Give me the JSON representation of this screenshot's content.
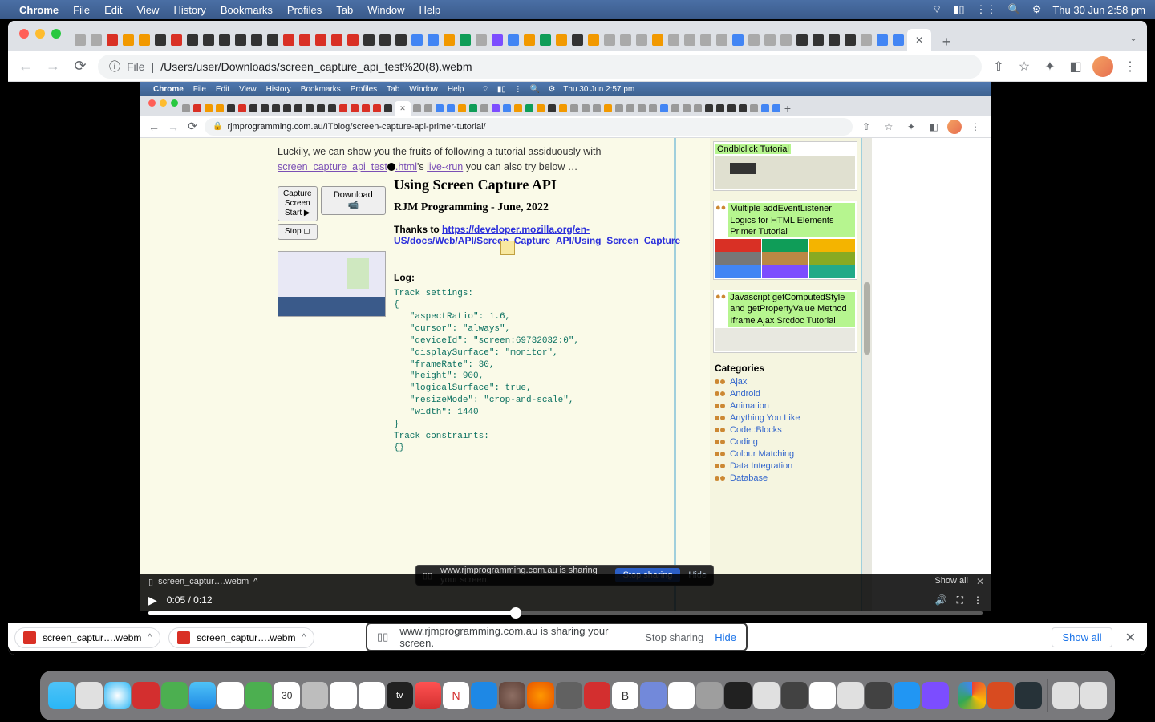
{
  "mac_menubar": {
    "app": "Chrome",
    "items": [
      "File",
      "Edit",
      "View",
      "History",
      "Bookmarks",
      "Profiles",
      "Tab",
      "Window",
      "Help"
    ],
    "clock": "Thu 30 Jun  2:58 pm"
  },
  "chrome": {
    "url_proto": "File",
    "url_path": "/Users/user/Downloads/screen_capture_api_test%20(8).webm",
    "info_icon": "ⓘ"
  },
  "inner_menubar": {
    "app": "Chrome",
    "items": [
      "File",
      "Edit",
      "View",
      "History",
      "Bookmarks",
      "Profiles",
      "Tab",
      "Window",
      "Help"
    ],
    "clock": "Thu 30 Jun  2:57 pm"
  },
  "inner_chrome": {
    "url": "rjmprogramming.com.au/ITblog/screen-capture-api-primer-tutorial/"
  },
  "blog": {
    "intro_a": "Luckily, we can show you the fruits of following a tutorial assiduously with ",
    "link1": "screen_capture_api_test",
    "link1_ext": ".html",
    "intro_b": "'s ",
    "link2": "live‑‹run",
    "intro_c": " you can also try below …",
    "btn_capture": "Capture\nScreen\nStart ▶",
    "btn_stop": "Stop ◻",
    "btn_download": "Download 📹",
    "title": "Using Screen Capture API",
    "subtitle": "RJM Programming - June, 2022",
    "thanks_pre": "Thanks to ",
    "thanks_link": "https://developer.mozilla.org/en-US/docs/Web/API/Screen_Capture_API/Using_Screen_Capture_",
    "log_label": "Log:",
    "log_pre": "Track settings:\n{\n   \"aspectRatio\": 1.6,\n   \"cursor\": \"always\",\n   \"deviceId\": \"screen:69732032:0\",\n   \"displaySurface\": \"monitor\",\n   \"frameRate\": 30,\n   \"height\": 900,\n   \"logicalSurface\": true,\n   \"resizeMode\": \"crop-and-scale\",\n   \"width\": 1440\n}\nTrack constraints:\n{}"
  },
  "sidebar": {
    "card1": "Ondblclick Tutorial",
    "card2": "Multiple addEventListener Logics for HTML Elements Primer Tutorial",
    "card3": "Javascript getComputedStyle and getPropertyValue Method Iframe Ajax Srcdoc Tutorial",
    "cat_title": "Categories",
    "cats": [
      "Ajax",
      "Android",
      "Animation",
      "Anything You Like",
      "Code::Blocks",
      "Coding",
      "Colour Matching",
      "Data Integration",
      "Database"
    ]
  },
  "video": {
    "chip_label": "screen_captur….webm",
    "chip_chev": "^",
    "time": "0:05 / 0:12",
    "show_all": "Show all"
  },
  "inner_share": {
    "msg": "www.rjmprogramming.com.au is sharing your screen.",
    "stop": "Stop sharing",
    "hide": "Hide"
  },
  "outer_share": {
    "msg": "www.rjmprogramming.com.au is sharing your screen.",
    "stop": "Stop sharing",
    "hide": "Hide"
  },
  "downloads": {
    "chip1": "screen_captur….webm",
    "chip2": "screen_captur….webm",
    "show_all": "Show all"
  }
}
